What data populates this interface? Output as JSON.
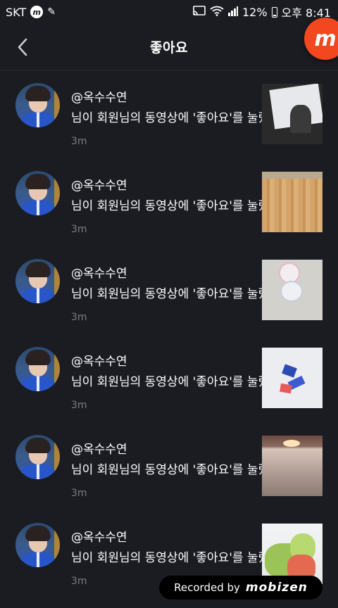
{
  "status_bar": {
    "carrier": "SKT",
    "battery": "12%",
    "time": "오후 8:41",
    "icons": [
      "mobizen-m-icon",
      "media-icon",
      "cast-icon",
      "wifi-icon",
      "signal-icon",
      "battery-icon"
    ]
  },
  "header": {
    "title": "좋아요",
    "back_icon": "chevron-left-icon"
  },
  "overlay": {
    "mobizen_button_letter": "m",
    "recorded_by": "Recorded by",
    "brand": "mobizen"
  },
  "notifications": [
    {
      "handle": "@옥수수연",
      "message": "님이 회원님의 동영상에 '좋아요'를 눌렀습니다",
      "time": "3m"
    },
    {
      "handle": "@옥수수연",
      "message": "님이 회원님의 동영상에 '좋아요'를 눌렀습니다",
      "time": "3m"
    },
    {
      "handle": "@옥수수연",
      "message": "님이 회원님의 동영상에 '좋아요'를 눌렀습니다",
      "time": "3m"
    },
    {
      "handle": "@옥수수연",
      "message": "님이 회원님의 동영상에 '좋아요'를 눌렀습니다",
      "time": "3m"
    },
    {
      "handle": "@옥수수연",
      "message": "님이 회원님의 동영상에 '좋아요'를 눌렀습니다",
      "time": "3m"
    },
    {
      "handle": "@옥수수연",
      "message": "님이 회원님의 동영상에 '좋아요'를 눌렀습니다",
      "time": "3m"
    }
  ],
  "colors": {
    "background": "#1b1c22",
    "time_text": "#7c7f88",
    "mobizen_accent": "#f2471f"
  }
}
